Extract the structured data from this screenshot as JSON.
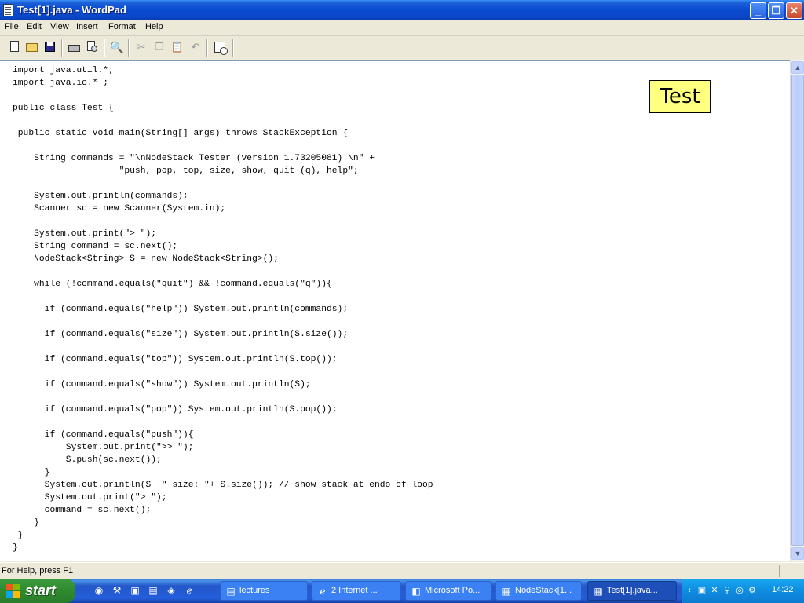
{
  "window": {
    "title": "Test[1].java - WordPad",
    "minimize_glyph": "_",
    "maximize_glyph": "❐",
    "close_glyph": "✕"
  },
  "menu": [
    "File",
    "Edit",
    "View",
    "Insert",
    "Format",
    "Help"
  ],
  "toolbar": {
    "icons": [
      "new-icon",
      "open-icon",
      "save-icon",
      "print-icon",
      "print-preview-icon",
      "find-icon",
      "cut-icon",
      "copy-icon",
      "paste-icon",
      "undo-icon",
      "date-time-icon"
    ],
    "find_glyph": "🔍",
    "cut_glyph": "✂",
    "copy_glyph": "❐",
    "paste_glyph": "📋",
    "undo_glyph": "↶"
  },
  "document": {
    "text": "import java.util.*;\nimport java.io.* ;\n\npublic class Test {\n\n public static void main(String[] args) throws StackException {\n\n    String commands = \"\\nNodeStack Tester (version 1.73205081) \\n\" +\n                    \"push, pop, top, size, show, quit (q), help\";\n\n    System.out.println(commands);\n    Scanner sc = new Scanner(System.in);\n\n    System.out.print(\"> \");\n    String command = sc.next();\n    NodeStack<String> S = new NodeStack<String>();\n\n    while (!command.equals(\"quit\") && !command.equals(\"q\")){\n\n      if (command.equals(\"help\")) System.out.println(commands);\n\n      if (command.equals(\"size\")) System.out.println(S.size());\n\n      if (command.equals(\"top\")) System.out.println(S.top());\n\n      if (command.equals(\"show\")) System.out.println(S);\n\n      if (command.equals(\"pop\")) System.out.println(S.pop());\n\n      if (command.equals(\"push\")){\n          System.out.print(\">> \");\n          S.push(sc.next());\n      }\n      System.out.println(S +\" size: \"+ S.size()); // show stack at endo of loop\n      System.out.print(\"> \");\n      command = sc.next();\n    }\n }\n}",
    "badge": "Test"
  },
  "scrollbar": {
    "up_glyph": "▲",
    "down_glyph": "▼"
  },
  "status": {
    "text": "For Help, press F1"
  },
  "taskbar": {
    "start_label": "start",
    "quick_launch_icons": [
      "ie-icon",
      "tool-icon",
      "cmd-icon",
      "folder-icon",
      "app-icon",
      "ie-icon"
    ],
    "quick_launch_glyphs": [
      "◉",
      "⚒",
      "▣",
      "▤",
      "◈",
      "ℯ"
    ],
    "tasks": [
      {
        "label": "lectures",
        "icon": "folder-icon",
        "glyph": "▤",
        "active": false
      },
      {
        "label": "2 Internet ...",
        "icon": "ie-icon",
        "glyph": "ℯ",
        "active": false
      },
      {
        "label": "Microsoft Po...",
        "icon": "powerpoint-icon",
        "glyph": "◧",
        "active": false
      },
      {
        "label": "NodeStack[1...",
        "icon": "wordpad-icon",
        "glyph": "▦",
        "active": false
      },
      {
        "label": "Test[1].java...",
        "icon": "wordpad-icon",
        "glyph": "▦",
        "active": true
      }
    ],
    "tray_glyphs": [
      "‹",
      "▣",
      "✕",
      "⚲",
      "◎",
      "⚙"
    ],
    "clock": "14:22"
  }
}
